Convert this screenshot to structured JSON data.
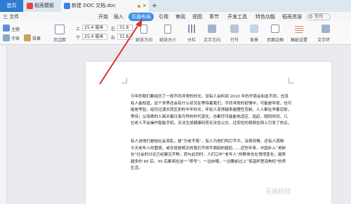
{
  "tabs": {
    "home": "首页",
    "daoke": "稻壳模板",
    "doc": "新建 DOC 文档.doc",
    "close": "×",
    "plus": "+"
  },
  "menu": {
    "file": "三 文件",
    "start": "开始",
    "insert": "插入",
    "page_layout": "页面布局",
    "reference": "引用",
    "review": "审阅",
    "view": "视图",
    "chapter": "章节",
    "dev_tools": "开发工具",
    "special": "特色功能",
    "premium": "稻壳资源",
    "search": "查找"
  },
  "ribbon": {
    "theme": "主题",
    "font": "字体",
    "effect": "效果",
    "margin": "页边距",
    "top_label": "上",
    "bottom_label": "下",
    "left_label": "左",
    "right_label": "右",
    "margin_top": "25.4 毫米",
    "margin_bottom": "25.4 毫米",
    "margin_left": "31.8",
    "margin_right": "31.8",
    "orientation": "纸张方向",
    "paper_size": "纸张大小",
    "columns": "分栏",
    "text_dir": "文字方向",
    "line_num": "行号",
    "background": "背景",
    "border": "页面边框",
    "manuscript": "稿纸设置",
    "text_wrap": "文字环"
  },
  "doc": {
    "para1": [
      "今年的我们都经历了一段不同寻常的时光，没有人会料到 2020 年的开局会如此不同，也没",
      "有人能知道，这个世界还会有什么状况在等待着我们，不同寻常的疫情中，可能是孕育，也可",
      "能是考验。经历过漫长而压抑的半年时光，年轻人变得越来越理性克制，人人都在学着忍耐，",
      "等待；父母辈的人面对着日渐月异的时代变化，也都尽可能能地适应、追赶、随同时间，几",
      "位老人不会操作智能手机，无法生成健康码而无法坐公交，过安检的视频在网上引发了热议。"
    ],
    "para2": [
      "有人说他们是给社会添乱，是“为老不尊”，有人为他们鸣打不平。深表同情，还有人感慨",
      "今天老年人的窘境，或许就是明天的我们不得不面临的尴尬……近些年来，中国步入“老龄",
      "化”社会的讨论已经屡见不鲜，而与此同时，人们口中“老年人”的群体也在悄悄变化，越来",
      "越多的 80 后、90 后都将在这一“称号”。一边自嘲，一边瞻前过上“保温杯里泡枸杞”的养",
      "生活。"
    ]
  },
  "watermark": "百度经验",
  "colors": {
    "home_tab": "#2f7cd3",
    "active_menu": "#3d8ee8",
    "arrow": "#e0302a"
  }
}
